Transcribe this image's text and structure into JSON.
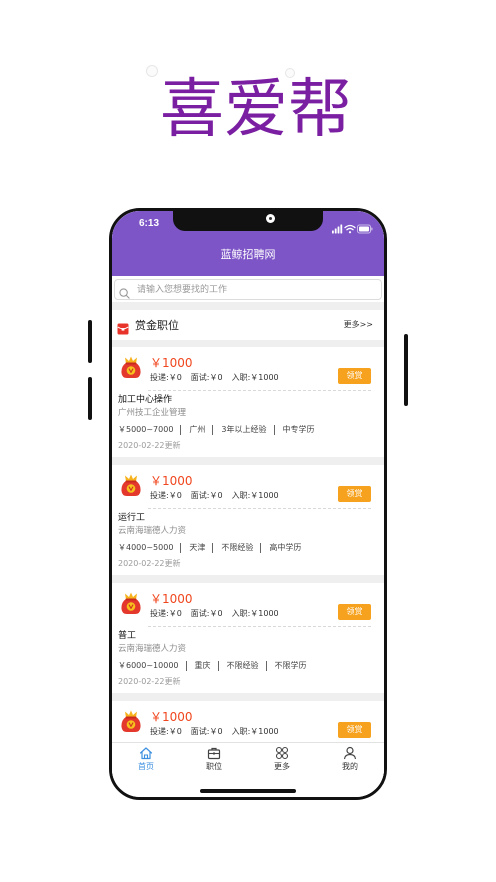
{
  "promo": {
    "title": "喜爱帮"
  },
  "status_bar": {
    "time": "6:13",
    "icons": [
      "signal-icon",
      "wifi-icon",
      "battery-icon"
    ]
  },
  "header": {
    "title": "蓝鲸招聘网"
  },
  "search": {
    "placeholder": "请输入您想要找的工作",
    "value": "",
    "icon": "search-icon"
  },
  "section": {
    "icon": "red-packet-icon",
    "title": "赏金职位",
    "more_label": "更多>>"
  },
  "jobs": [
    {
      "icon": "reward-bag-icon",
      "reward": "￥1000",
      "delivery": "投递:￥0",
      "interview": "面试:￥0",
      "onboard": "入职:￥1000",
      "claim_label": "领赏",
      "title": "加工中心操作",
      "company": "广州技工企业管理",
      "salary": "￥5000~7000",
      "city": "广州",
      "experience": "3年以上经验",
      "education": "中专学历",
      "updated": "2020-02-22更新"
    },
    {
      "icon": "reward-bag-icon",
      "reward": "￥1000",
      "delivery": "投递:￥0",
      "interview": "面试:￥0",
      "onboard": "入职:￥1000",
      "claim_label": "领赏",
      "title": "运行工",
      "company": "云南海瑞德人力资",
      "salary": "￥4000~5000",
      "city": "天津",
      "experience": "不限经验",
      "education": "高中学历",
      "updated": "2020-02-22更新"
    },
    {
      "icon": "reward-bag-icon",
      "reward": "￥1000",
      "delivery": "投递:￥0",
      "interview": "面试:￥0",
      "onboard": "入职:￥1000",
      "claim_label": "领赏",
      "title": "普工",
      "company": "云南海瑞德人力资",
      "salary": "￥6000~10000",
      "city": "重庆",
      "experience": "不限经验",
      "education": "不限学历",
      "updated": "2020-02-22更新"
    },
    {
      "icon": "reward-bag-icon",
      "reward": "￥1000",
      "delivery": "投递:￥0",
      "interview": "面试:￥0",
      "onboard": "入职:￥1000",
      "claim_label": "领赏"
    }
  ],
  "tabs": [
    {
      "label": "首页",
      "icon": "home-icon",
      "active": true
    },
    {
      "label": "职位",
      "icon": "briefcase-icon",
      "active": false
    },
    {
      "label": "更多",
      "icon": "grid-icon",
      "active": false
    },
    {
      "label": "我的",
      "icon": "user-icon",
      "active": false
    }
  ],
  "colors": {
    "promo_title": "#7b1fa2",
    "header": "#7d55c7",
    "reward": "#f0461e",
    "claim_button": "#f6a21e",
    "tab_active": "#3d8fe0",
    "band": "#efefef",
    "section_icon": "#e8332a"
  }
}
